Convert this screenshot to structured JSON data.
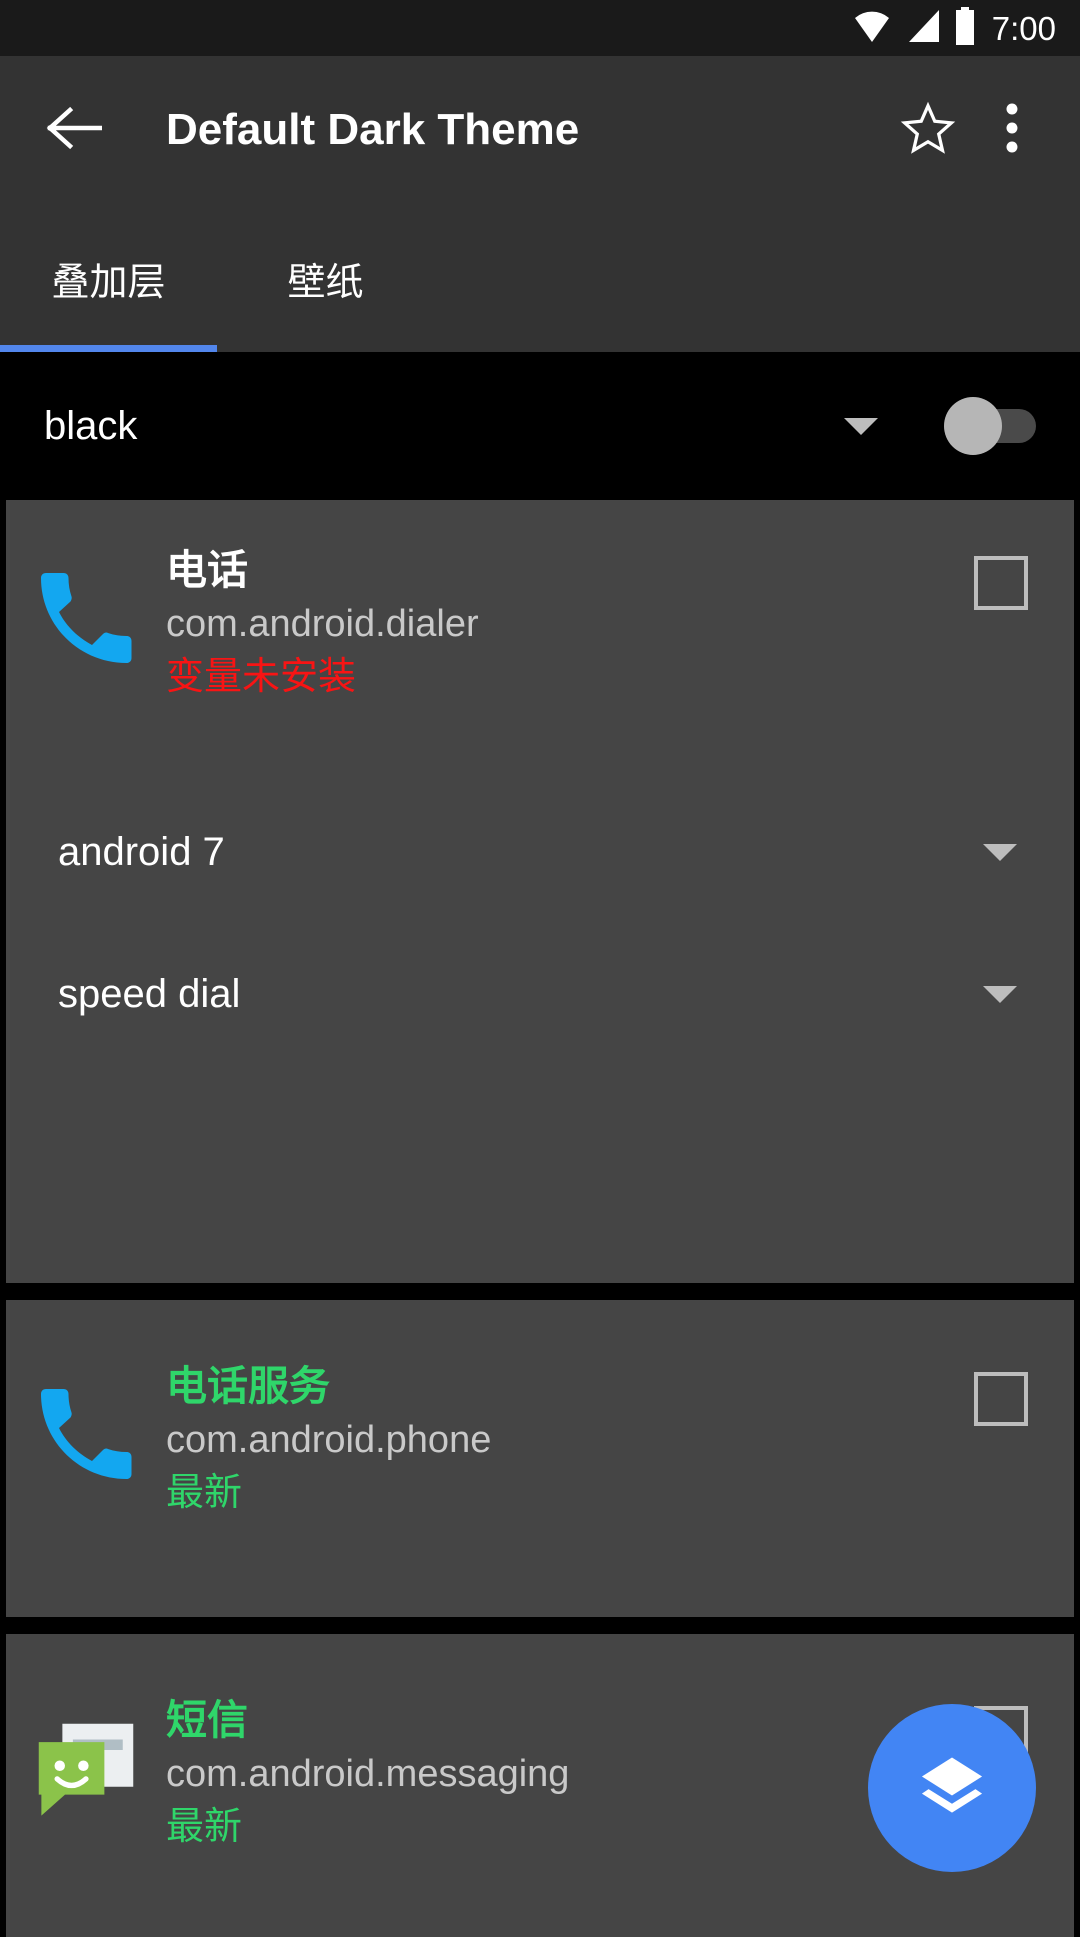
{
  "status_bar": {
    "time": "7:00",
    "icons": [
      "wifi-icon",
      "cell-signal-icon",
      "battery-icon"
    ]
  },
  "app_bar": {
    "title": "Default Dark Theme",
    "back_icon": "back-arrow-icon",
    "favorite_icon": "star-outline-icon",
    "overflow_icon": "overflow-menu-icon"
  },
  "tabs": [
    {
      "label": "叠加层",
      "active": true
    },
    {
      "label": "壁纸",
      "active": false
    }
  ],
  "theme_selector": {
    "value": "black",
    "caret_icon": "chevron-down-icon",
    "toggle_state": "off"
  },
  "colors": {
    "accent_blue": "#5286ec",
    "fab_blue": "#4285f4",
    "card_bg": "#454545",
    "app_bar_bg": "#333333",
    "status_bar_bg": "#1a1a1a",
    "error_red": "#f81414",
    "updated_green": "#2fd66a",
    "phone_icon_blue": "#13a7f0",
    "sms_icon_green": "#8bc34a"
  },
  "cards": [
    {
      "icon": "phone-icon",
      "label": "电话",
      "label_color": "white",
      "package": "com.android.dialer",
      "state": "变量未安装",
      "state_color": "red",
      "checkbox_checked": false,
      "spinners": [
        {
          "value": "android 7"
        },
        {
          "value": "speed dial"
        }
      ]
    },
    {
      "icon": "phone-icon",
      "label": "电话服务",
      "label_color": "green",
      "package": "com.android.phone",
      "state": "最新",
      "state_color": "green",
      "checkbox_checked": false,
      "spinners": []
    },
    {
      "icon": "sms-icon",
      "label": "短信",
      "label_color": "green",
      "package": "com.android.messaging",
      "state": "最新",
      "state_color": "green",
      "checkbox_checked": false,
      "spinners": []
    }
  ],
  "fab": {
    "icon": "layers-icon"
  }
}
